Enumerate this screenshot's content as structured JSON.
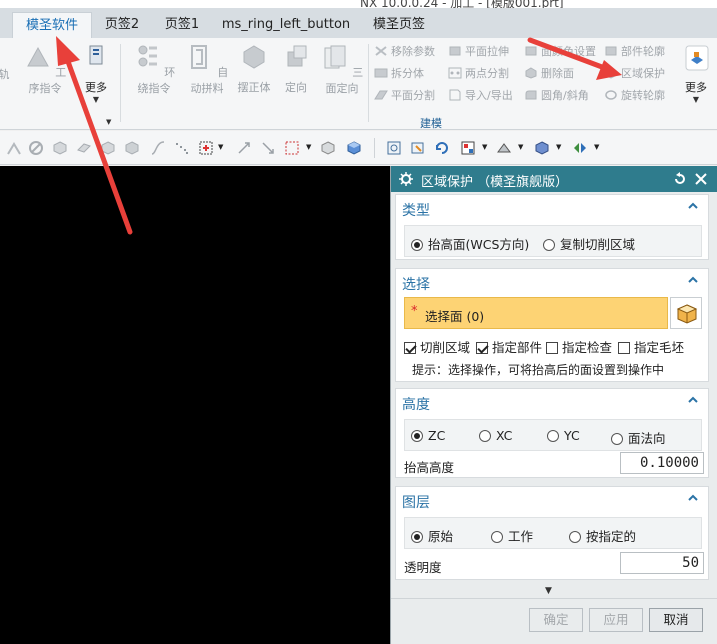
{
  "window": {
    "title": "NX 10.0.0.24 - 加工 - [模版001.prt]"
  },
  "tabs": [
    {
      "label": "模圣软件",
      "active": true
    },
    {
      "label": "页签2"
    },
    {
      "label": "页签1"
    },
    {
      "label": "ms_ring_left_button"
    },
    {
      "label": "模圣页签"
    }
  ],
  "ribbon": {
    "left_cut": "轨",
    "op_cmd": "工序指令",
    "more1": "更多",
    "ring_cmd": "环绕指令",
    "auto_split": "自动拼料",
    "move_solid": "摆正体",
    "orient": "定向",
    "three_view": "三面定向",
    "small": {
      "remove_param": "移除参数",
      "plane_stretch": "平面拉伸",
      "face_color": "面颜色设置",
      "part_outline": "部件轮廓",
      "split_solid": "拆分体",
      "two_point_split": "两点分割",
      "delete_face": "删除面",
      "region_protect": "区域保护",
      "plane_split": "平面分割",
      "import_export": "导入/导出",
      "round_chamfer": "圆角/斜角",
      "rotate_outline": "旋转轮廓"
    },
    "more2": "更多",
    "group_label": "建模"
  },
  "dialog": {
    "title": "区域保护 （模圣旗舰版）",
    "type_section": {
      "title": "类型",
      "options": [
        "抬高面(WCS方向)",
        "复制切削区域"
      ],
      "selected": 0
    },
    "select_section": {
      "title": "选择",
      "select_face": "选择面 (0)",
      "required_mark": "*",
      "checkboxes": [
        {
          "label": "切削区域",
          "checked": true
        },
        {
          "label": "指定部件",
          "checked": true
        },
        {
          "label": "指定检查",
          "checked": false
        },
        {
          "label": "指定毛坯",
          "checked": false
        }
      ],
      "hint": "提示：选择操作，可将抬高后的面设置到操作中"
    },
    "height_section": {
      "title": "高度",
      "options": [
        "ZC",
        "XC",
        "YC",
        "面法向"
      ],
      "selected": 0,
      "lift_label": "抬高高度",
      "lift_value": "0.10000"
    },
    "layer_section": {
      "title": "图层",
      "options": [
        "原始",
        "工作",
        "按指定的"
      ],
      "selected": 0,
      "transparency_label": "透明度",
      "transparency_value": "50"
    },
    "buttons": {
      "ok": "确定",
      "apply": "应用",
      "cancel": "取消"
    }
  },
  "colors": {
    "dialog_header": "#2f7c8d",
    "section_title": "#2b73a6",
    "selection_highlight": "#fdd374",
    "annotation_arrow": "#e8403a"
  }
}
